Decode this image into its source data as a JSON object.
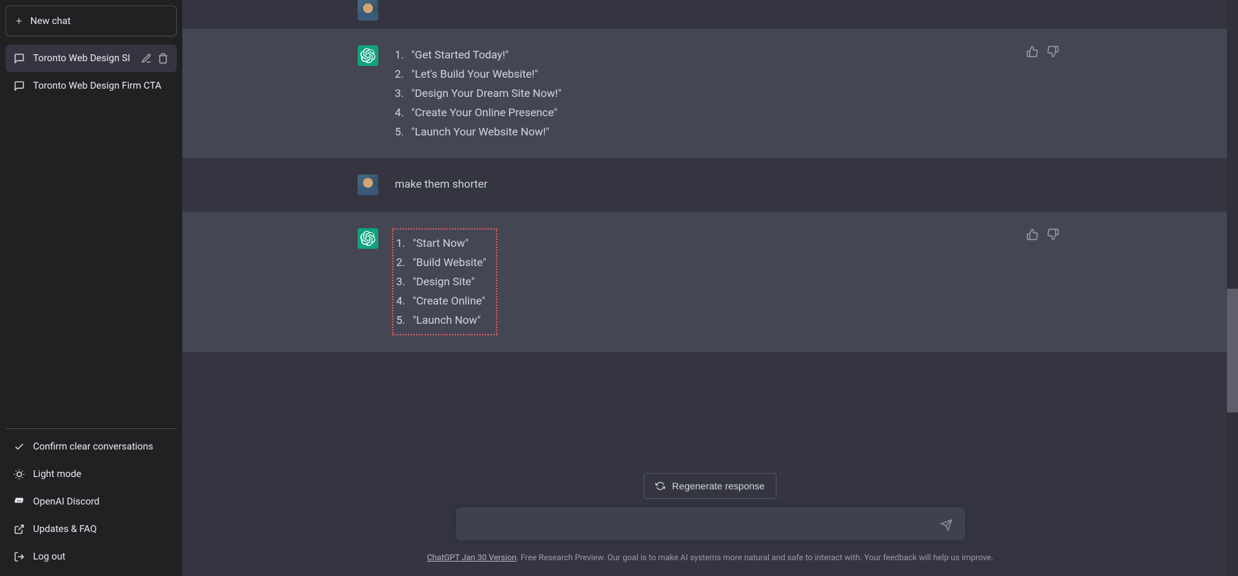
{
  "sidebar": {
    "new_chat_label": "New chat",
    "conversations": [
      {
        "title": "Toronto Web Design SI",
        "active": true
      },
      {
        "title": "Toronto Web Design Firm CTA",
        "active": false
      }
    ],
    "bottom_menu": {
      "confirm_clear": "Confirm clear conversations",
      "light_mode": "Light mode",
      "discord": "OpenAI Discord",
      "updates_faq": "Updates & FAQ",
      "logout": "Log out"
    }
  },
  "chat": {
    "response1": {
      "items": [
        "\"Get Started Today!\"",
        "\"Let's Build Your Website!\"",
        "\"Design Your Dream Site Now!\"",
        "\"Create Your Online Presence\"",
        "\"Launch Your Website Now!\""
      ]
    },
    "user1": "make them shorter",
    "response2": {
      "items": [
        "\"Start Now\"",
        "\"Build Website\"",
        "\"Design Site\"",
        "\"Create Online\"",
        "\"Launch Now\""
      ]
    }
  },
  "controls": {
    "regenerate": "Regenerate response",
    "input_placeholder": ""
  },
  "footer": {
    "link": "ChatGPT Jan 30 Version",
    "text": ". Free Research Preview. Our goal is to make AI systems more natural and safe to interact with. Your feedback will help us improve."
  }
}
